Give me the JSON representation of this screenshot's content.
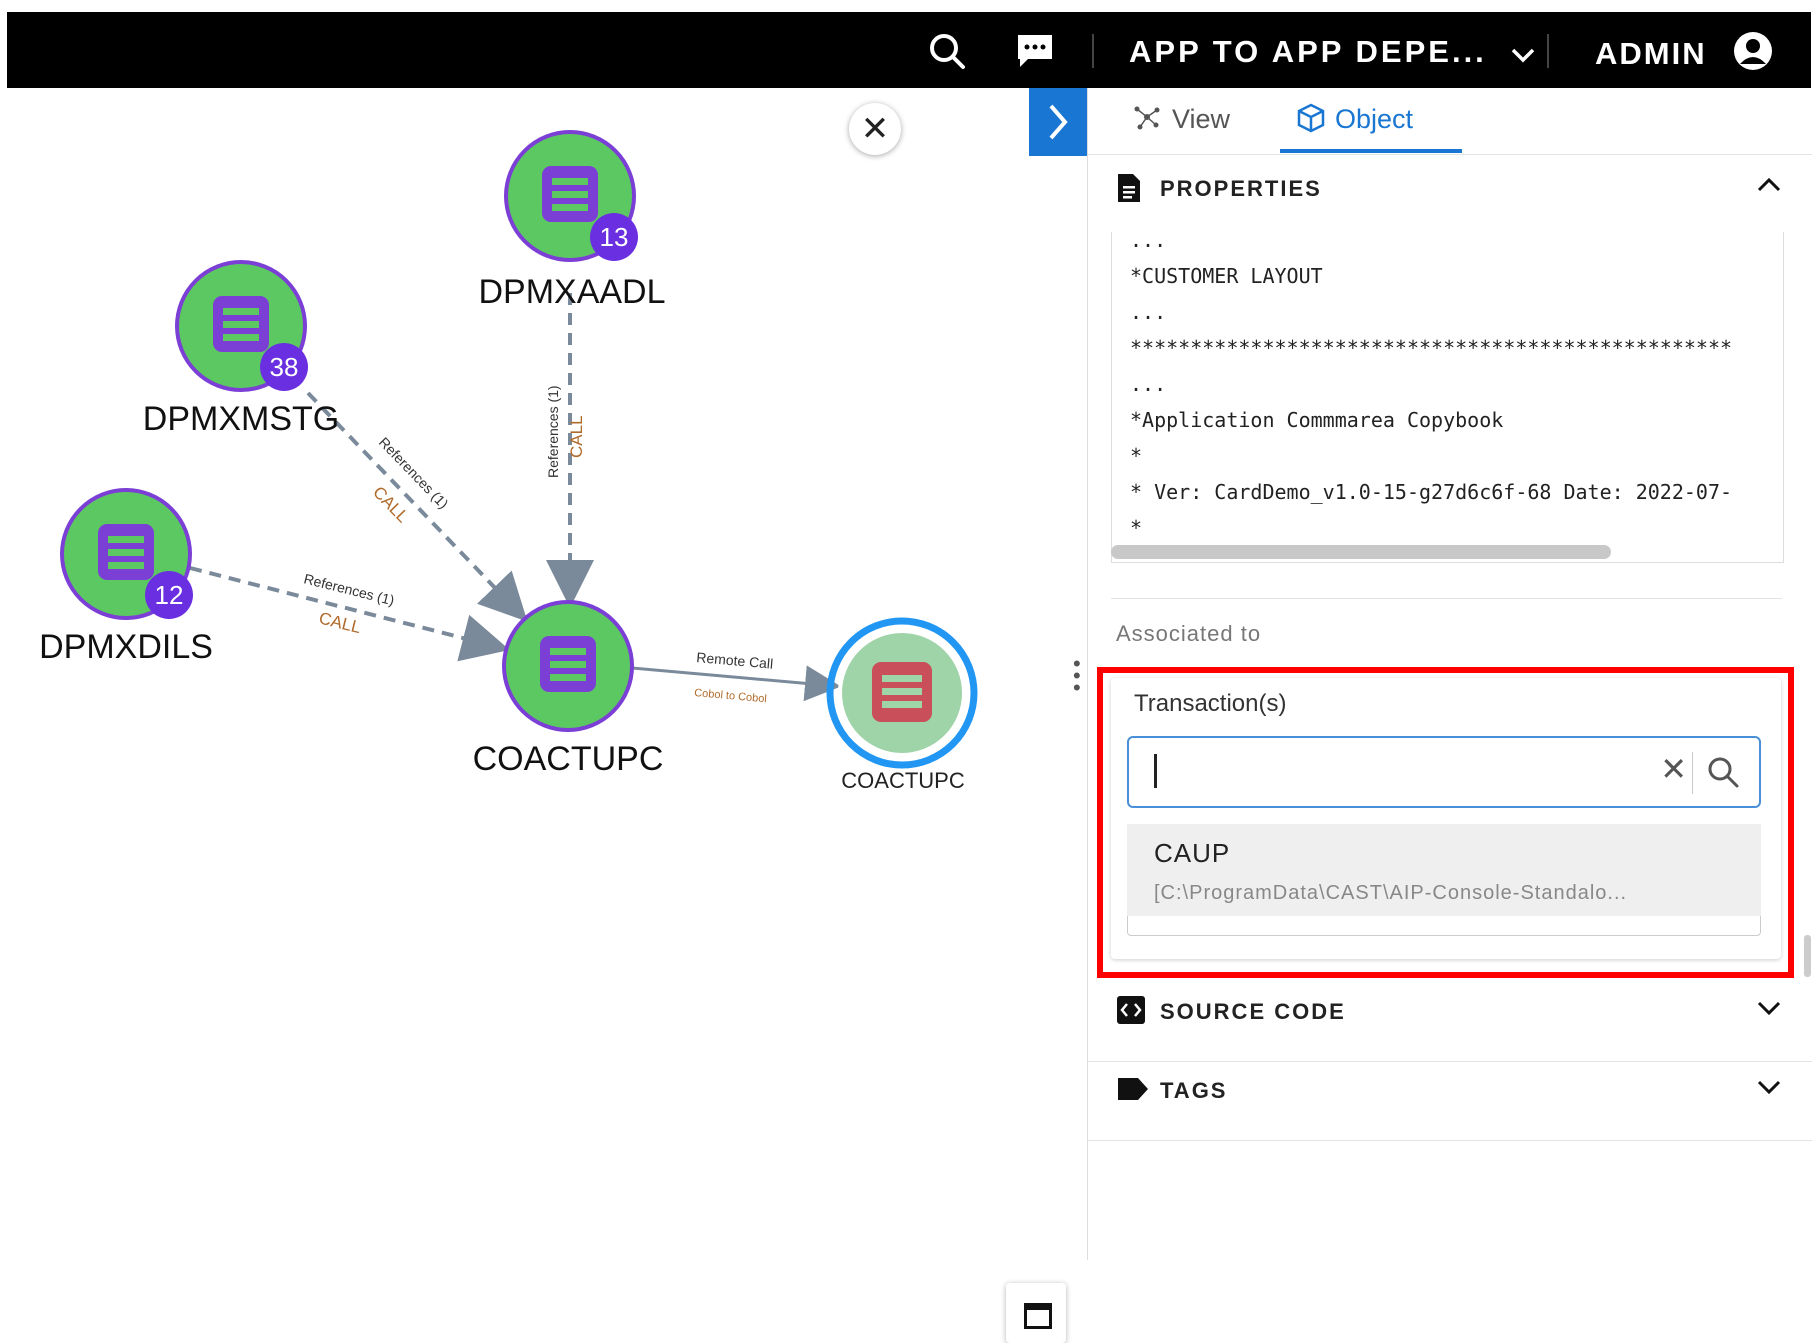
{
  "topbar": {
    "app_name": "APP TO APP DEPE...",
    "user": "ADMIN",
    "icons": [
      "search-icon",
      "chat-icon",
      "chevron-down-icon",
      "user-avatar-icon"
    ]
  },
  "graph": {
    "nodes": [
      {
        "name": "DPMXAADL",
        "badge": "13"
      },
      {
        "name": "DPMXMSTG",
        "badge": "38"
      },
      {
        "name": "DPMXDILS",
        "badge": "12"
      },
      {
        "name": "COACTUPC",
        "badge": ""
      },
      {
        "name": "COACTUPC",
        "badge": ""
      }
    ],
    "edges": [
      {
        "from": "DPMXAADL",
        "to": "COACTUPC",
        "label": "References (1)",
        "sublabel": "CALL"
      },
      {
        "from": "DPMXMSTG",
        "to": "COACTUPC",
        "label": "References (1)",
        "sublabel": "CALL"
      },
      {
        "from": "DPMXDILS",
        "to": "COACTUPC",
        "label": "References (1)",
        "sublabel": "CALL"
      },
      {
        "from": "COACTUPC",
        "to": "COACTUPC",
        "label": "Remote Call",
        "sublabel": "Cobol to Cobol"
      }
    ],
    "colors": {
      "node_fill": "#5cc862",
      "node_ring": "#7b3fd6",
      "badge": "#6a2fe0",
      "target_fill": "#9fd3a8",
      "target_ring": "#2196f3",
      "target_icon": "#c9505a",
      "edge": "#7a8a9a",
      "edge_sublabel": "#b06a2a"
    }
  },
  "panel": {
    "tabs": [
      {
        "label": "View",
        "active": false
      },
      {
        "label": "Object",
        "active": true
      }
    ],
    "properties": {
      "title": "PROPERTIES",
      "code_lines": [
        "...",
        "*CUSTOMER LAYOUT",
        "...",
        "**************************************************",
        "...",
        "*Application Commmarea Copybook",
        "*",
        "* Ver: CardDemo_v1.0-15-g27d6c6f-68 Date: 2022-07-",
        "*"
      ]
    },
    "associated_to": "Associated to",
    "transactions": {
      "label": "Transaction(s)",
      "value": "",
      "option_name": "CAUP",
      "option_path": "[C:\\ProgramData\\CAST\\AIP-Console-Standalo..."
    },
    "source_code": {
      "title": "SOURCE CODE"
    },
    "tags": {
      "title": "TAGS"
    }
  }
}
